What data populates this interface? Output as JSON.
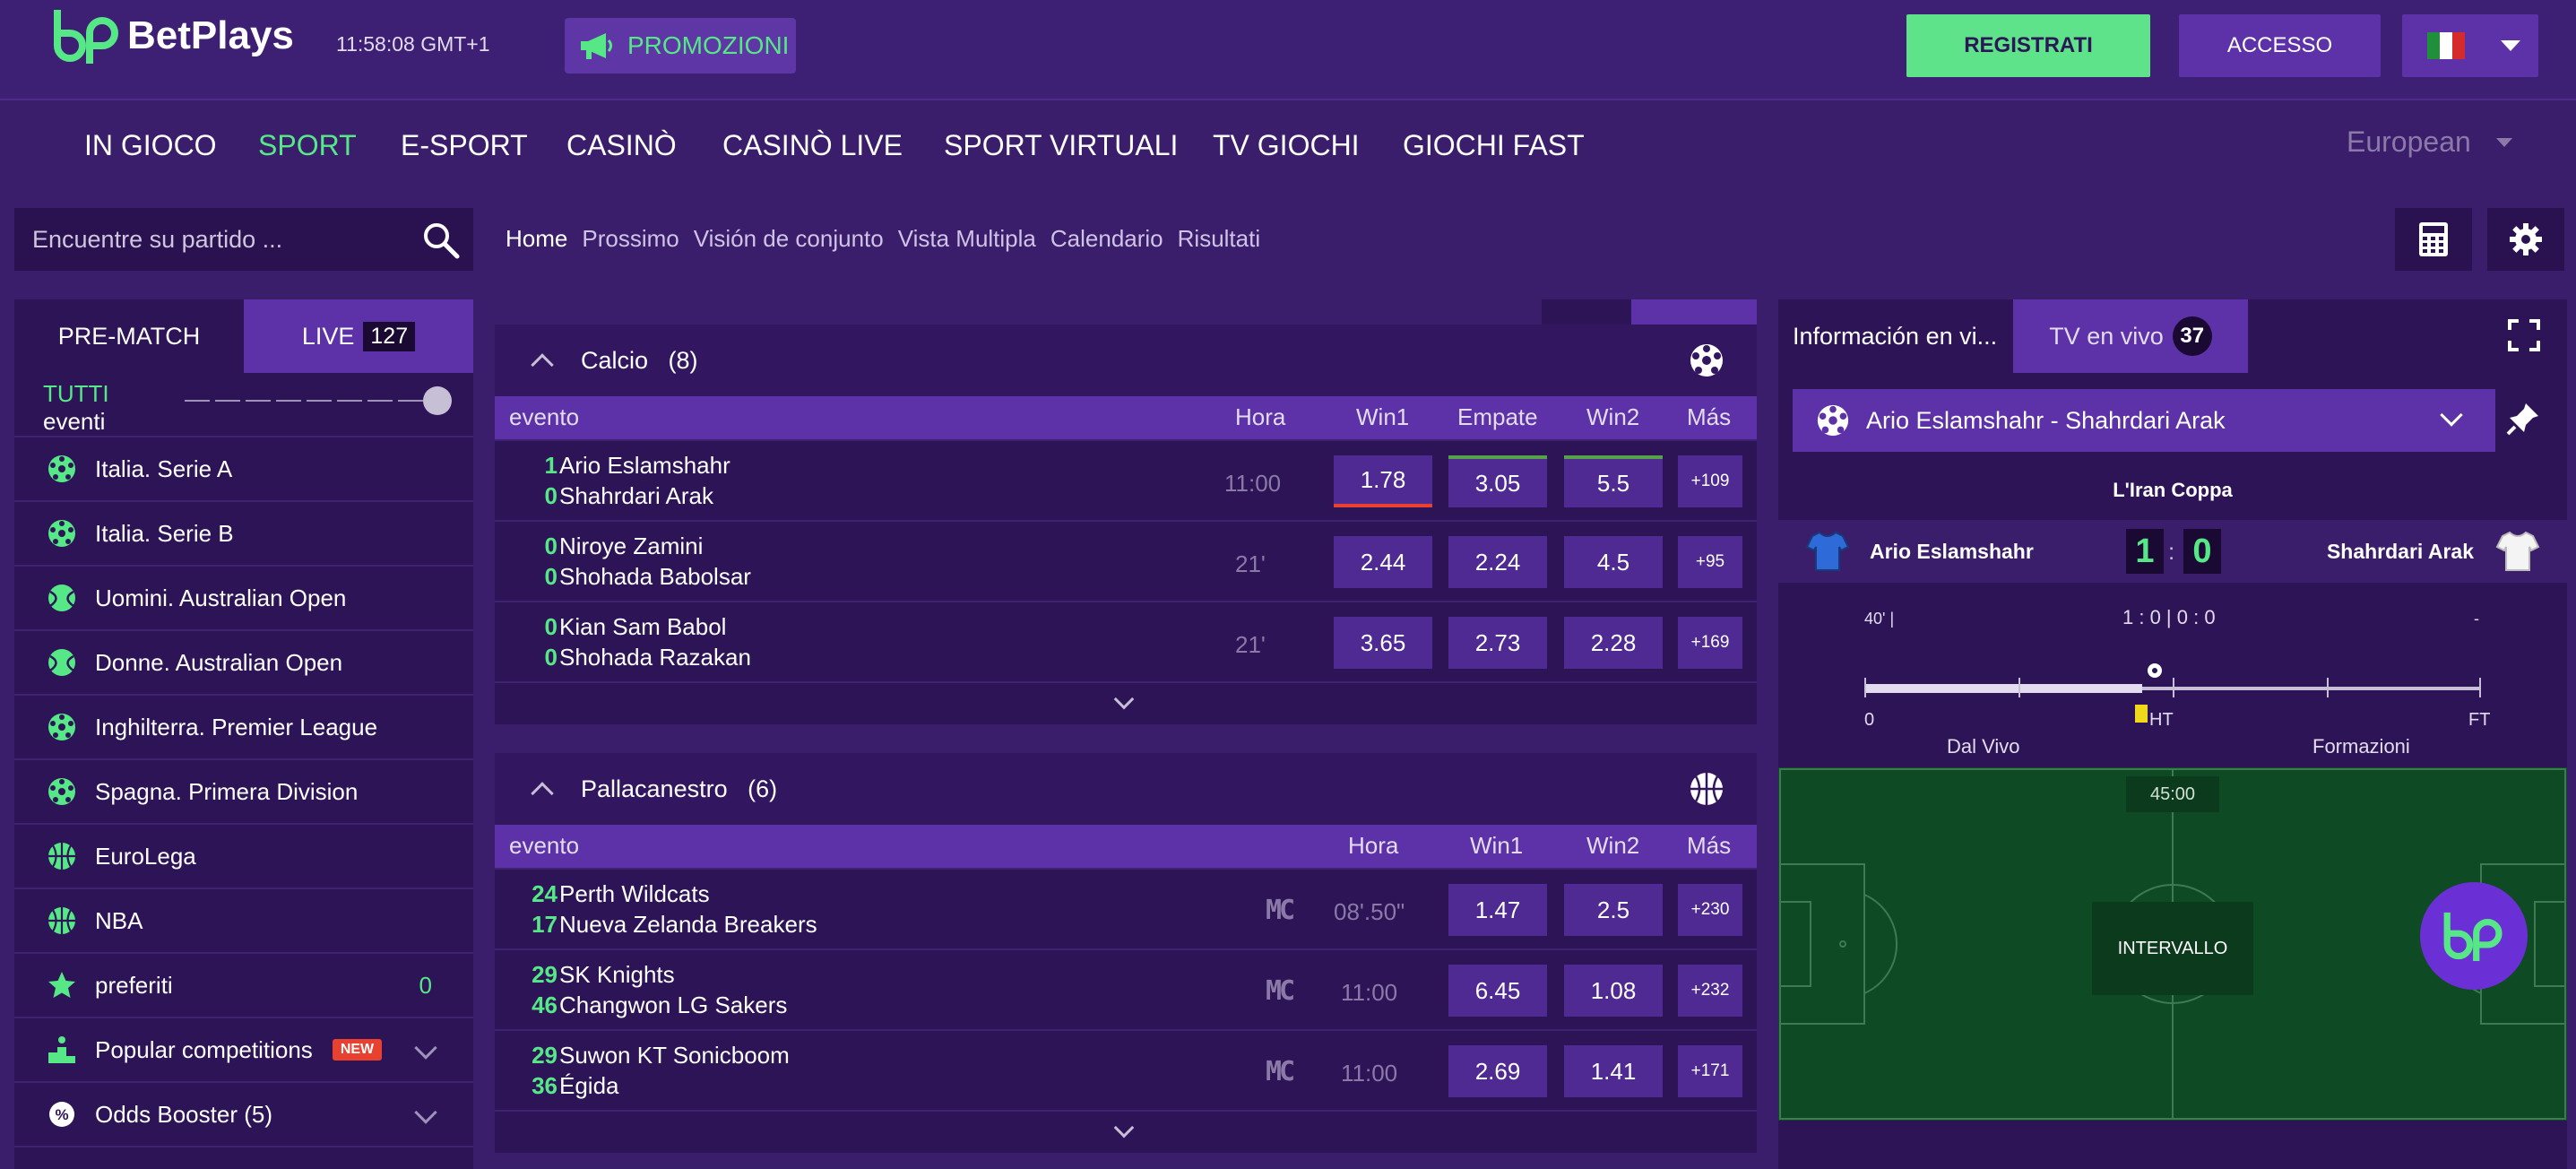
{
  "header": {
    "brand": "BetPlays",
    "clock": "11:58:08  GMT+1",
    "promo_label": "PROMOZIONI",
    "register_label": "REGISTRATI",
    "login_label": "ACCESSO"
  },
  "nav": {
    "items": [
      "IN GIOCO",
      "SPORT",
      "E-SPORT",
      "CASINÒ",
      "CASINÒ LIVE",
      "SPORT VIRTUALI",
      "TV GIOCHI",
      "GIOCHI FAST"
    ],
    "active": "SPORT",
    "odds_format": "European"
  },
  "search": {
    "placeholder": "Encuentre su partido ..."
  },
  "subtabs": [
    "Home",
    "Prossimo",
    "Visión de conjunto",
    "Vista Multipla",
    "Calendario",
    "Risultati"
  ],
  "left": {
    "tab_prematch": "PRE-MATCH",
    "tab_live": "LIVE",
    "live_count": "127",
    "tutti": "TUTTI",
    "eventi": "eventi",
    "items": [
      {
        "label": "Italia. Serie A",
        "icon": "soccer-ball-icon"
      },
      {
        "label": "Italia. Serie B",
        "icon": "soccer-ball-icon"
      },
      {
        "label": "Uomini. Australian Open",
        "icon": "tennis-ball-icon"
      },
      {
        "label": "Donne. Australian Open",
        "icon": "tennis-ball-icon"
      },
      {
        "label": "Inghilterra. Premier League",
        "icon": "soccer-ball-icon"
      },
      {
        "label": "Spagna. Primera Division",
        "icon": "soccer-ball-icon"
      },
      {
        "label": "EuroLega",
        "icon": "basketball-icon"
      },
      {
        "label": "NBA",
        "icon": "basketball-icon"
      }
    ],
    "favorites_label": "preferiti",
    "favorites_count": "0",
    "popular_label": "Popular competitions",
    "new_badge": "NEW",
    "booster_label": "Odds Booster (5)"
  },
  "calcio": {
    "title": "Calcio",
    "count": "(8)",
    "cols": {
      "evento": "evento",
      "hora": "Hora",
      "win1": "Win1",
      "empate": "Empate",
      "win2": "Win2",
      "mas": "Más"
    },
    "rows": [
      {
        "s1": "1",
        "s2": "0",
        "t1": "Ario Eslamshahr",
        "t2": "Shahrdari Arak",
        "time": "11:00",
        "w1": "1.78",
        "x": "3.05",
        "w2": "5.5",
        "more": "+109"
      },
      {
        "s1": "0",
        "s2": "0",
        "t1": "Niroye Zamini",
        "t2": "Shohada Babolsar",
        "time": "21'",
        "w1": "2.44",
        "x": "2.24",
        "w2": "4.5",
        "more": "+95"
      },
      {
        "s1": "0",
        "s2": "0",
        "t1": "Kian Sam Babol",
        "t2": "Shohada Razakan",
        "time": "21'",
        "w1": "3.65",
        "x": "2.73",
        "w2": "2.28",
        "more": "+169"
      }
    ]
  },
  "basket": {
    "title": "Pallacanestro",
    "count": "(6)",
    "cols": {
      "evento": "evento",
      "hora": "Hora",
      "win1": "Win1",
      "win2": "Win2",
      "mas": "Más"
    },
    "rows": [
      {
        "s1": "24",
        "s2": "17",
        "t1": "Perth Wildcats",
        "t2": "Nueva Zelanda Breakers",
        "mc": "MC",
        "time": "08'.50\"",
        "w1": "1.47",
        "w2": "2.5",
        "more": "+230"
      },
      {
        "s1": "29",
        "s2": "46",
        "t1": "SK Knights",
        "t2": "Changwon LG Sakers",
        "mc": "MC",
        "time": "11:00",
        "w1": "6.45",
        "w2": "1.08",
        "more": "+232"
      },
      {
        "s1": "29",
        "s2": "36",
        "t1": "Suwon KT Sonicboom",
        "t2": "Égida",
        "mc": "MC",
        "time": "11:00",
        "w1": "2.69",
        "w2": "1.41",
        "more": "+171"
      }
    ]
  },
  "right": {
    "tab_info": "Información en vi...",
    "tab_tv": "TV en vivo",
    "tv_count": "37",
    "match": "Ario Eslamshahr - Shahrdari Arak",
    "competition": "L'Iran Coppa",
    "home": "Ario Eslamshahr",
    "away": "Shahrdari Arak",
    "home_score": "1",
    "away_score": "0",
    "minute": "40' |",
    "halves": "1 : 0 | 0 : 0",
    "dash": "-",
    "tl_start": "0",
    "tl_ht": "HT",
    "tl_ft": "FT",
    "dal_vivo": "Dal Vivo",
    "formazioni": "Formazioni",
    "pitch_time": "45:00",
    "interval": "INTERVALLO"
  }
}
